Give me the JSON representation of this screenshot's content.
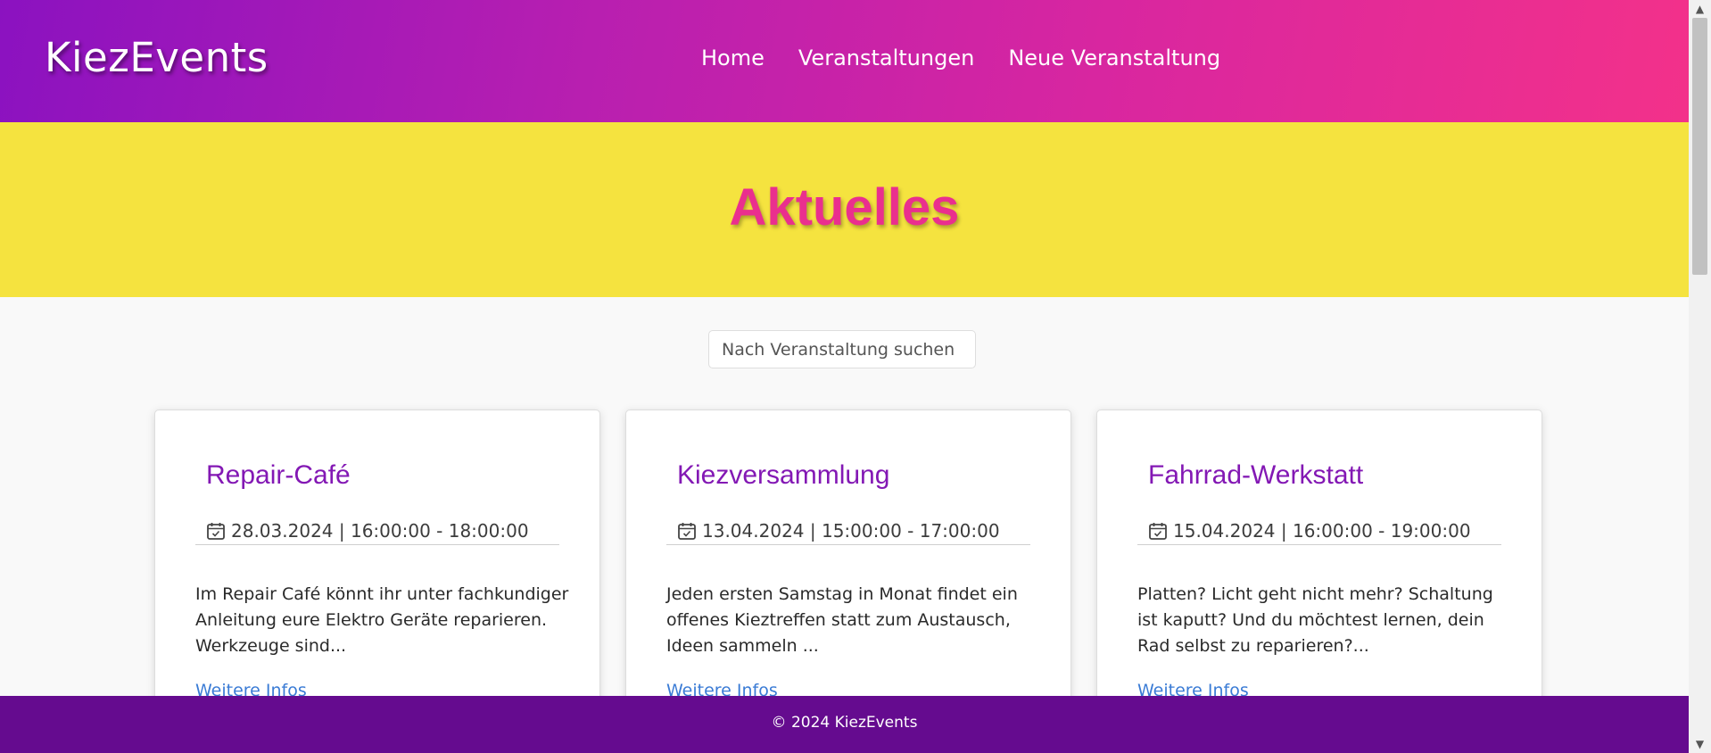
{
  "header": {
    "logo": "KiezEvents",
    "nav": [
      "Home",
      "Veranstaltungen",
      "Neue Veranstaltung"
    ]
  },
  "hero": {
    "title": "Aktuelles"
  },
  "search": {
    "placeholder": "Nach Veranstaltung suchen"
  },
  "events": [
    {
      "title": "Repair-Café",
      "datetime": "28.03.2024 | 16:00:00 - 18:00:00",
      "description": "Im Repair Café könnt ihr unter fachkundiger Anleitung eure Elektro Geräte reparieren. Werkzeuge sind...",
      "link": "Weitere Infos"
    },
    {
      "title": "Kiezversammlung",
      "datetime": "13.04.2024 | 15:00:00 - 17:00:00",
      "description": "Jeden ersten Samstag in Monat findet ein offenes Kieztreffen statt zum Austausch, Ideen sammeln ...",
      "link": "Weitere Infos"
    },
    {
      "title": "Fahrrad-Werkstatt",
      "datetime": "15.04.2024 | 16:00:00 - 19:00:00",
      "description": "Platten? Licht geht nicht mehr? Schaltung ist kaputt? Und du möchtest lernen, dein Rad selbst zu reparieren?...",
      "link": "Weitere Infos"
    }
  ],
  "footer": {
    "text": "© 2024 KiezEvents"
  },
  "icons": {
    "event_date": "calendar-icon"
  },
  "colors": {
    "header_gradient_start": "#8b12c0",
    "header_gradient_end": "#f3318a",
    "hero_background": "#f5e33f",
    "hero_title": "#ea2f8e",
    "card_title": "#8318b4",
    "link": "#3a7bd5",
    "footer_background": "#650b8f"
  }
}
